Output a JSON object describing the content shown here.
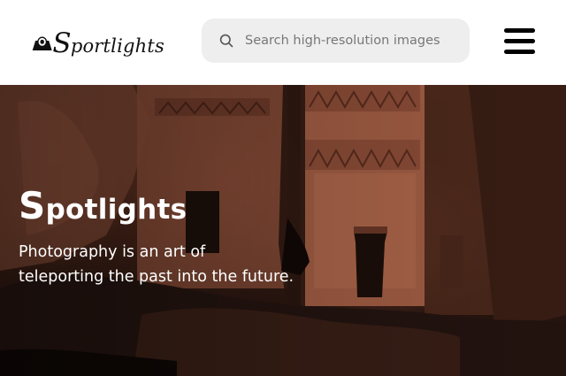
{
  "header": {
    "logo": {
      "text_initial": "S",
      "text_rest": "portlights"
    },
    "search": {
      "placeholder": "Search high-resolution images",
      "icon": "search-icon"
    },
    "menu": {
      "icon": "hamburger-menu-icon"
    }
  },
  "hero": {
    "title_initial": "S",
    "title_rest": "potlights",
    "tagline_line1": "Photography is an art of",
    "tagline_line2": "teleporting the past into the future."
  },
  "colors": {
    "header_bg": "#ffffff",
    "search_bg": "#eeeeee",
    "text_on_image": "#ffffff",
    "menu_icon": "#000000"
  }
}
